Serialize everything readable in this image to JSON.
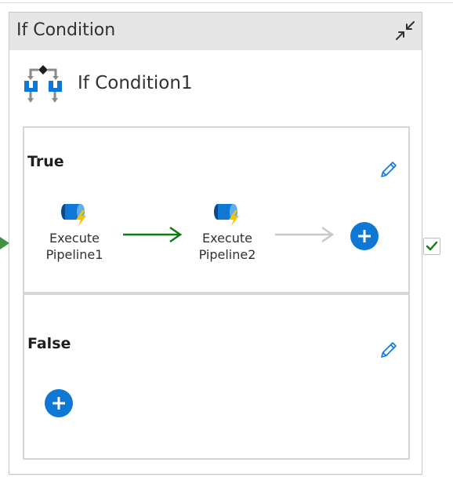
{
  "header": {
    "title": "If Condition",
    "collapse_icon": "collapse-arrows-icon"
  },
  "activity": {
    "name": "If Condition1",
    "icon": "if-condition-icon"
  },
  "branches": [
    {
      "label": "True",
      "edit_icon": "pencil-icon",
      "activities": [
        {
          "label_line1": "Execute",
          "label_line2": "Pipeline1",
          "icon": "execute-pipeline-icon"
        },
        {
          "label_line1": "Execute",
          "label_line2": "Pipeline2",
          "icon": "execute-pipeline-icon"
        }
      ],
      "add_icon": "plus-icon"
    },
    {
      "label": "False",
      "edit_icon": "pencil-icon",
      "activities": [],
      "add_icon": "plus-icon"
    }
  ],
  "colors": {
    "header_bg": "#e6e6e6",
    "accent_blue": "#0f78d4",
    "success_green": "#107c10",
    "connector_gray": "#c8c8c8"
  },
  "success_port": {
    "icon": "checkmark-icon"
  }
}
